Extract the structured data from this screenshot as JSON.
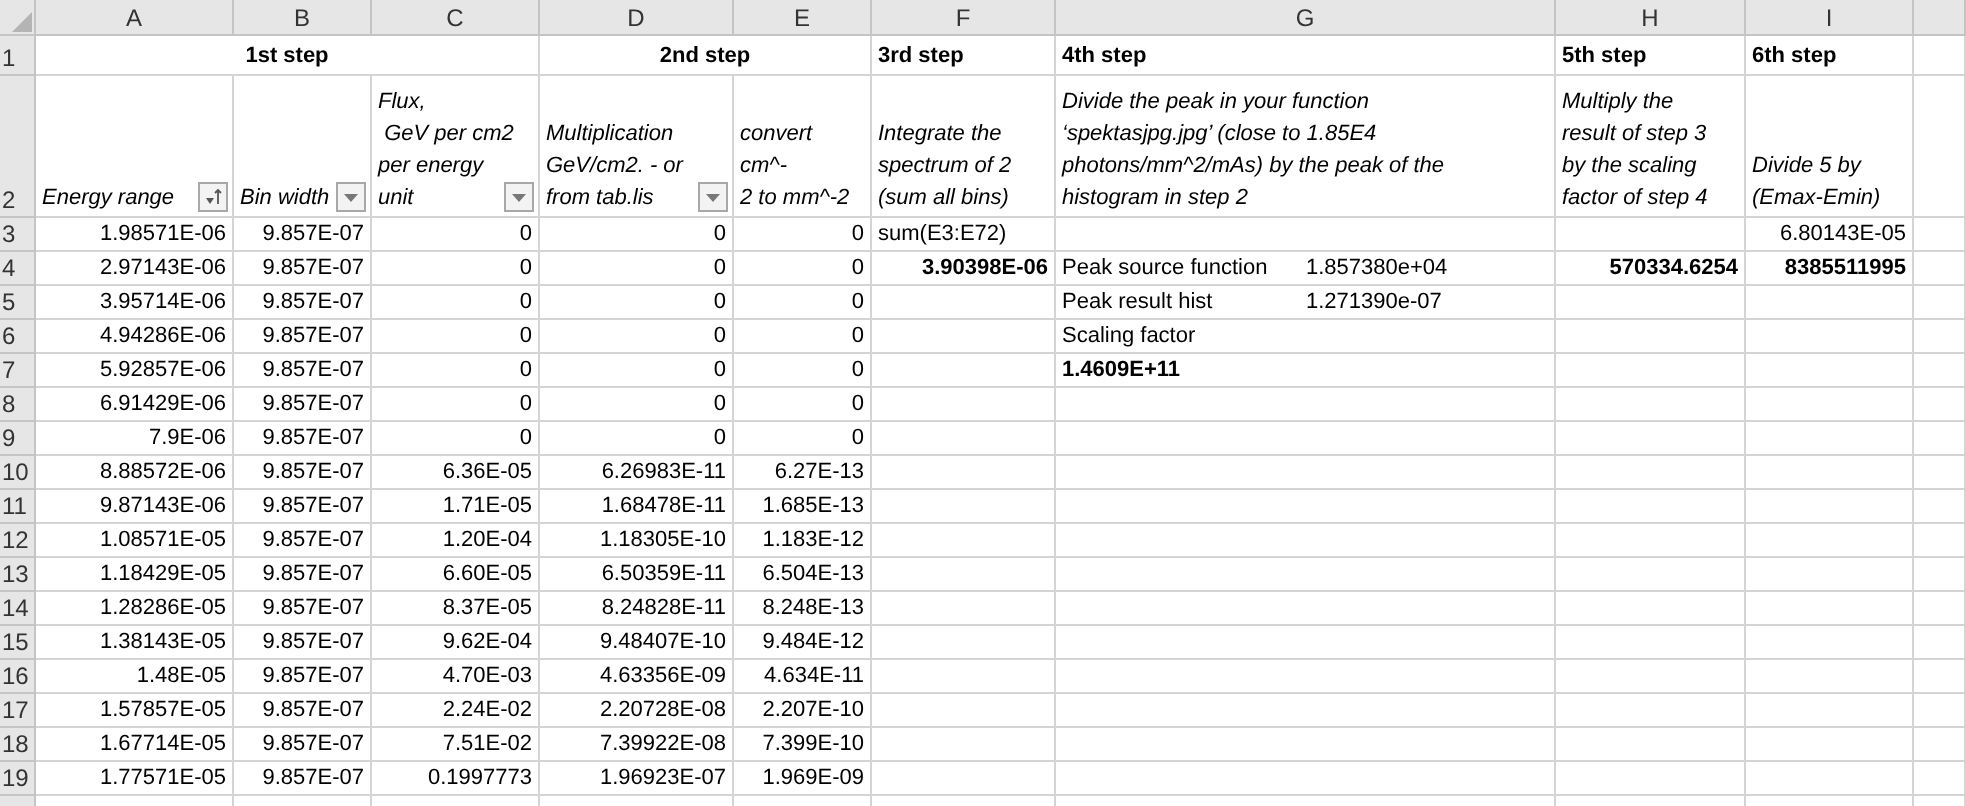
{
  "columns": [
    {
      "letter": "A",
      "step": "1st step"
    },
    {
      "letter": "B"
    },
    {
      "letter": "C"
    },
    {
      "letter": "D",
      "step": "2nd step"
    },
    {
      "letter": "E"
    },
    {
      "letter": "F",
      "step": "3rd step"
    },
    {
      "letter": "G",
      "step": "4th step"
    },
    {
      "letter": "H",
      "step": "5th step"
    },
    {
      "letter": "I",
      "step": "6th step"
    }
  ],
  "step_header": {
    "row": "1"
  },
  "field_header": {
    "row": "2",
    "cells": [
      {
        "text": "Energy range",
        "kind": "sorted"
      },
      {
        "text": "Bin width",
        "kind": "filter"
      },
      {
        "text": "Flux,\n GeV per cm2\nper energy\nunit",
        "kind": "filter"
      },
      {
        "text": "Multiplication\nGeV/cm2. - or\nfrom tab.lis",
        "kind": "filter"
      },
      {
        "text": "convert cm^-\n2 to mm^-2"
      },
      {
        "text": "Integrate the\nspectrum of 2\n(sum all bins)"
      },
      {
        "text": "Divide the peak in your function\n‘spektasjpg.jpg’ (close to 1.85E4\nphotons/mm^2/mAs) by the peak of the\nhistogram in step 2"
      },
      {
        "text": "Multiply the\nresult of step 3\nby the scaling\nfactor of step 4"
      },
      {
        "text": "Divide 5 by\n(Emax-Emin)"
      }
    ]
  },
  "rows": [
    {
      "num": "3",
      "cells": {
        "A": "1.98571E-06",
        "B": "9.857E-07",
        "C": "0",
        "D": "0",
        "E": "0",
        "F": {
          "text": "sum(E3:E72)",
          "kind": "text"
        },
        "I": "6.80143E-05"
      }
    },
    {
      "num": "4",
      "cells": {
        "A": "2.97143E-06",
        "B": "9.857E-07",
        "C": "0",
        "D": "0",
        "E": "0",
        "F": {
          "text": "3.90398E-06",
          "bold": true
        },
        "G": {
          "text": "Peak source function",
          "value": "1.857380e+04",
          "kind": "text"
        },
        "H": {
          "text": "570334.6254",
          "bold": true
        },
        "I": {
          "text": "8385511995",
          "bold": true
        }
      }
    },
    {
      "num": "5",
      "cells": {
        "A": "3.95714E-06",
        "B": "9.857E-07",
        "C": "0",
        "D": "0",
        "E": "0",
        "G": {
          "text": "Peak result hist",
          "value": "1.271390e-07",
          "kind": "text"
        }
      }
    },
    {
      "num": "6",
      "cells": {
        "A": "4.94286E-06",
        "B": "9.857E-07",
        "C": "0",
        "D": "0",
        "E": "0",
        "G": {
          "text": "Scaling factor",
          "kind": "text"
        }
      }
    },
    {
      "num": "7",
      "cells": {
        "A": "5.92857E-06",
        "B": "9.857E-07",
        "C": "0",
        "D": "0",
        "E": "0",
        "G": {
          "text": "1.4609E+11",
          "kind": "text",
          "bold": true
        }
      }
    },
    {
      "num": "8",
      "cells": {
        "A": "6.91429E-06",
        "B": "9.857E-07",
        "C": "0",
        "D": "0",
        "E": "0"
      }
    },
    {
      "num": "9",
      "cells": {
        "A": "7.9E-06",
        "B": "9.857E-07",
        "C": "0",
        "D": "0",
        "E": "0"
      }
    },
    {
      "num": "10",
      "cells": {
        "A": "8.88572E-06",
        "B": "9.857E-07",
        "C": "6.36E-05",
        "D": "6.26983E-11",
        "E": "6.27E-13"
      }
    },
    {
      "num": "11",
      "cells": {
        "A": "9.87143E-06",
        "B": "9.857E-07",
        "C": "1.71E-05",
        "D": "1.68478E-11",
        "E": "1.685E-13"
      }
    },
    {
      "num": "12",
      "cells": {
        "A": "1.08571E-05",
        "B": "9.857E-07",
        "C": "1.20E-04",
        "D": "1.18305E-10",
        "E": "1.183E-12"
      }
    },
    {
      "num": "13",
      "cells": {
        "A": "1.18429E-05",
        "B": "9.857E-07",
        "C": "6.60E-05",
        "D": "6.50359E-11",
        "E": "6.504E-13"
      }
    },
    {
      "num": "14",
      "cells": {
        "A": "1.28286E-05",
        "B": "9.857E-07",
        "C": "8.37E-05",
        "D": "8.24828E-11",
        "E": "8.248E-13"
      }
    },
    {
      "num": "15",
      "cells": {
        "A": "1.38143E-05",
        "B": "9.857E-07",
        "C": "9.62E-04",
        "D": "9.48407E-10",
        "E": "9.484E-12"
      }
    },
    {
      "num": "16",
      "cells": {
        "A": "1.48E-05",
        "B": "9.857E-07",
        "C": "4.70E-03",
        "D": "4.63356E-09",
        "E": "4.634E-11"
      }
    },
    {
      "num": "17",
      "cells": {
        "A": "1.57857E-05",
        "B": "9.857E-07",
        "C": "2.24E-02",
        "D": "2.20728E-08",
        "E": "2.207E-10"
      }
    },
    {
      "num": "18",
      "cells": {
        "A": "1.67714E-05",
        "B": "9.857E-07",
        "C": "7.51E-02",
        "D": "7.39922E-08",
        "E": "7.399E-10"
      }
    },
    {
      "num": "19",
      "cells": {
        "A": "1.77571E-05",
        "B": "9.857E-07",
        "C": "0.1997773",
        "D": "1.96923E-07",
        "E": "1.969E-09"
      }
    }
  ]
}
